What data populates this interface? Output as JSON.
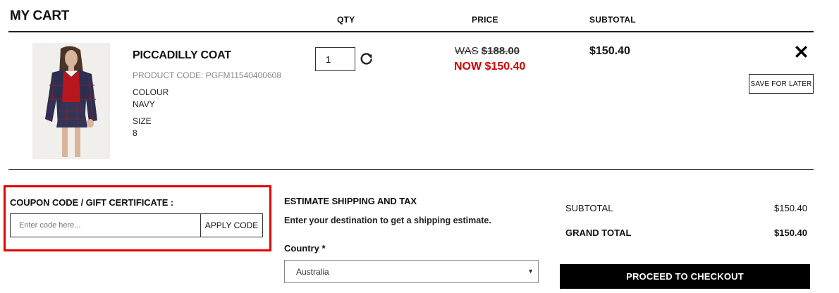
{
  "cart": {
    "title": "MY CART",
    "columns": {
      "qty": "QTY",
      "price": "PRICE",
      "subtotal": "SUBTOTAL"
    }
  },
  "item": {
    "name": "PICCADILLY COAT",
    "product_code": "PRODUCT CODE: PGFM11540400608",
    "colour_label": "COLOUR",
    "colour_value": "NAVY",
    "size_label": "SIZE",
    "size_value": "8",
    "qty": "1",
    "was_label": "WAS",
    "was_price": "$188.00",
    "now_price": "NOW $150.40",
    "subtotal": "$150.40",
    "save_for_later": "SAVE FOR LATER",
    "icons": {
      "refresh": "refresh-icon",
      "remove": "close-icon"
    }
  },
  "coupon": {
    "label": "COUPON CODE / GIFT CERTIFICATE :",
    "placeholder": "Enter code here...",
    "apply_label": "APPLY CODE"
  },
  "shipping": {
    "title": "ESTIMATE SHIPPING AND TAX",
    "subtitle": "Enter your destination to get a shipping estimate.",
    "country_label": "Country *",
    "country_value": "Australia"
  },
  "totals": {
    "subtotal_label": "SUBTOTAL",
    "subtotal_value": "$150.40",
    "grand_total_label": "GRAND TOTAL",
    "grand_total_value": "$150.40",
    "checkout_label": "PROCEED TO CHECKOUT"
  },
  "colors": {
    "sale_red": "#d10000",
    "highlight_red": "#e60000",
    "checkout_bg": "#000000"
  }
}
